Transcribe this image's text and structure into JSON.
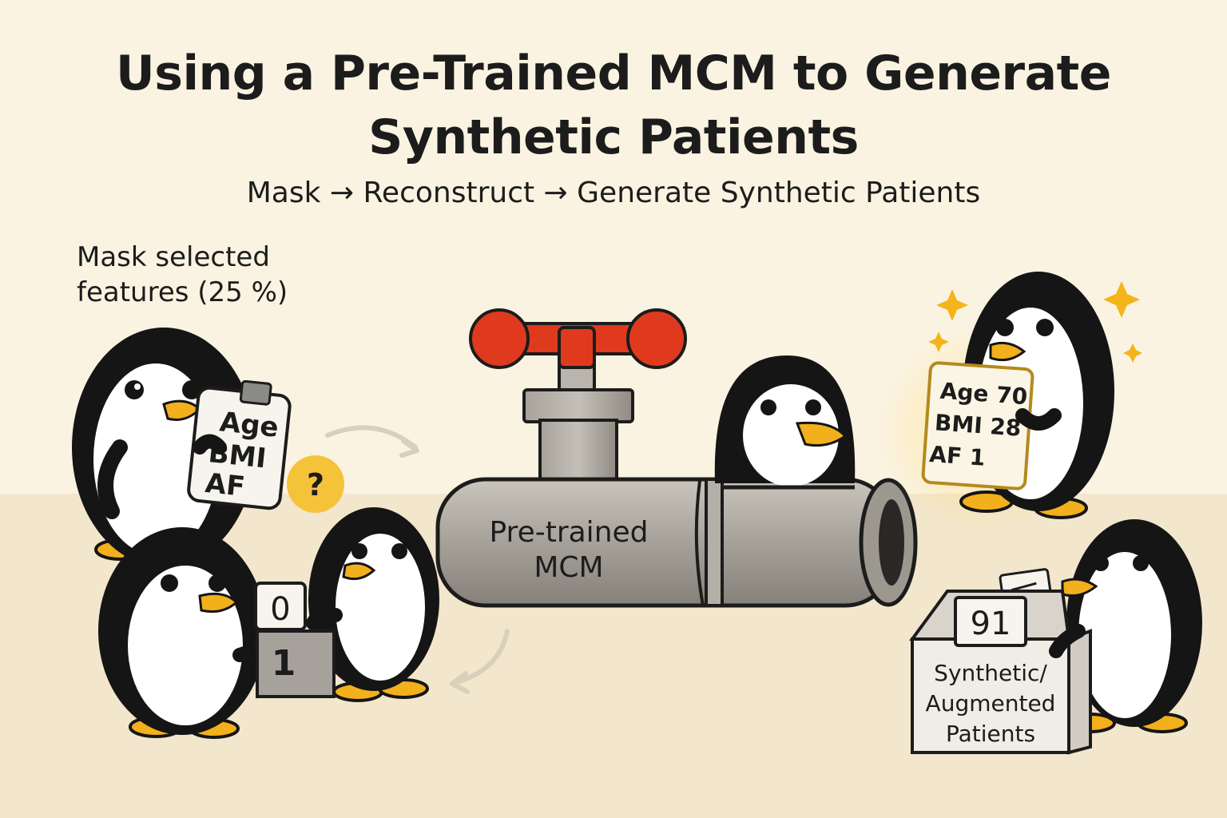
{
  "title": {
    "line1": "Using a Pre-Trained MCM to Generate",
    "line2": "Synthetic Patients"
  },
  "subtitle": "Mask → Reconstruct → Generate Synthetic Patients",
  "mask_step": {
    "label_line1": "Mask selected",
    "label_line2": "features (25 %)",
    "clipboard_lines": [
      "Age",
      "BMI",
      "AF"
    ],
    "question_mark": "?"
  },
  "mask_tokens": {
    "top": "0",
    "bottom": "1"
  },
  "model": {
    "label_line1": "Pre-trained",
    "label_line2": "MCM"
  },
  "output_card": {
    "lines": [
      "Age 70",
      "BMI 28",
      "AF  1"
    ]
  },
  "output_box": {
    "number": "91",
    "label_line1": "Synthetic/",
    "label_line2": "Augmented",
    "label_line3": "Patients"
  },
  "colors": {
    "background": "#fbf3e1",
    "floor": "#f2e6cc",
    "valve_red": "#e03a1e",
    "pipe_gray": "#a8a49c",
    "penguin_black": "#151515",
    "beak_yellow": "#f2b01c",
    "sparkle_gold": "#f4b41a"
  }
}
